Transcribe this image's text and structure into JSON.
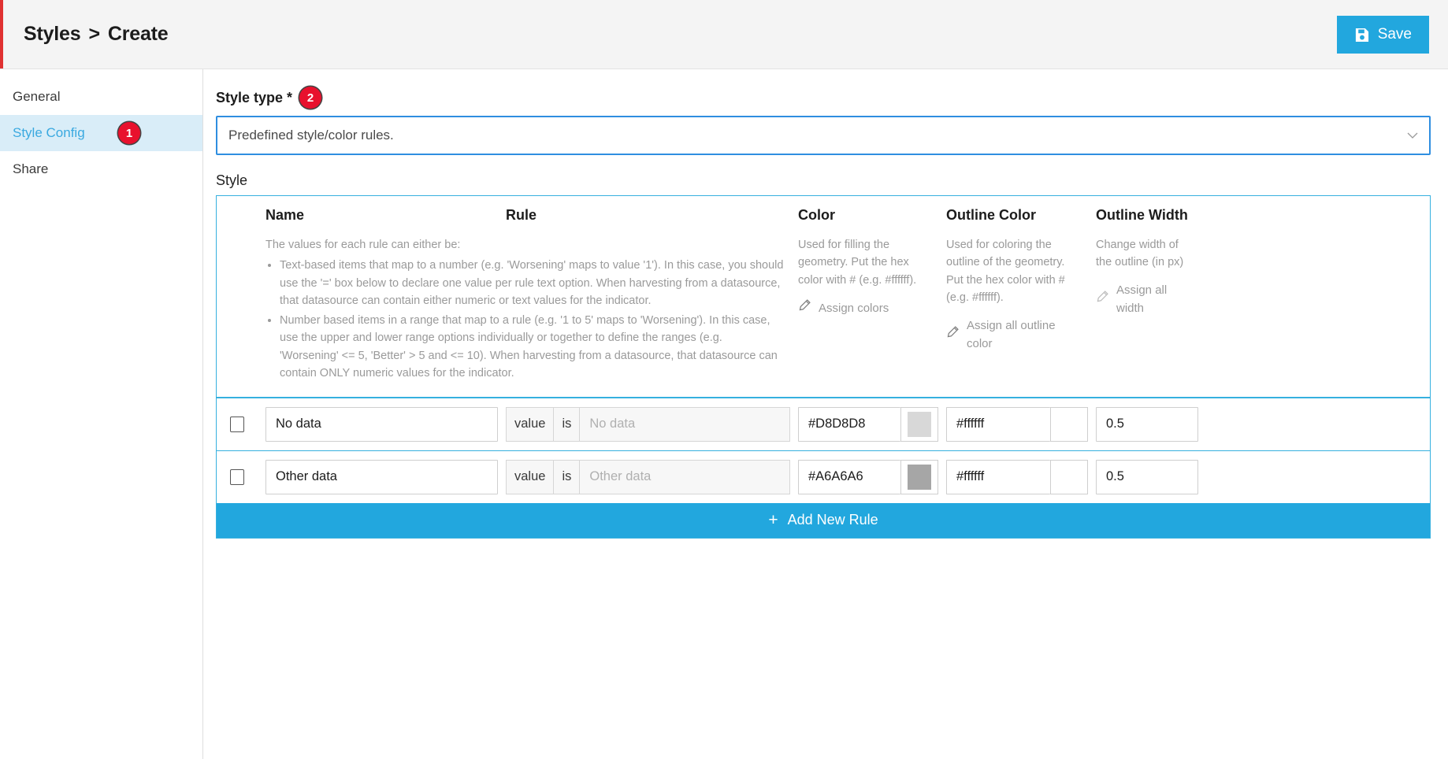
{
  "header": {
    "breadcrumb_root": "Styles",
    "breadcrumb_sep": ">",
    "breadcrumb_current": "Create",
    "save_label": "Save",
    "save_icon": "floppy-disk-icon",
    "accent_color": "#e8112d",
    "save_bg": "#22a7de"
  },
  "sidebar": {
    "items": [
      {
        "label": "General",
        "active": false,
        "badge": ""
      },
      {
        "label": "Style Config",
        "active": true,
        "badge": "1"
      },
      {
        "label": "Share",
        "active": false,
        "badge": ""
      }
    ]
  },
  "main": {
    "style_type_label": "Style type *",
    "style_type_badge": "2",
    "style_type_value": "Predefined style/color rules.",
    "style_type_chevron": "chevron-down-icon",
    "style_section_label": "Style"
  },
  "table": {
    "columns": {
      "name": "Name",
      "rule": "Rule",
      "color": "Color",
      "outline_color": "Outline Color",
      "outline_width": "Outline Width"
    },
    "name_rule_description": {
      "intro": "The values for each rule can either be:",
      "bullets": [
        "Text-based items that map to a number (e.g. 'Worsening' maps to value '1'). In this case, you should use the '=' box below to declare one value per rule text option. When harvesting from a datasource, that datasource can contain either numeric or text values for the indicator.",
        "Number based items in a range that map to a rule (e.g. '1 to 5' maps to 'Worsening'). In this case, use the upper and lower range options individually or together to define the ranges (e.g. 'Worsening' <= 5, 'Better' > 5 and <= 10). When harvesting from a datasource, that datasource can contain ONLY numeric values for the indicator."
      ]
    },
    "color_description": "Used for filling the geometry. Put the hex color with # (e.g. #ffffff).",
    "color_assign_link": "Assign colors",
    "outline_color_description": "Used for coloring the outline of the geometry. Put the hex color with # (e.g. #ffffff).",
    "outline_color_assign_link": "Assign all outline color",
    "outline_width_description": "Change width of the outline (in px)",
    "outline_width_assign_link": "Assign all width",
    "assign_icon": "pencil-icon",
    "rows": [
      {
        "checked": false,
        "name": "No data",
        "rule_tag_value": "value",
        "rule_tag_is": "is",
        "rule_placeholder": "No data",
        "rule_value": "",
        "color": "#D8D8D8",
        "color_swatch": "#D8D8D8",
        "outline_color": "#ffffff",
        "outline_swatch": "#ffffff",
        "outline_width": "0.5"
      },
      {
        "checked": false,
        "name": "Other data",
        "rule_tag_value": "value",
        "rule_tag_is": "is",
        "rule_placeholder": "Other data",
        "rule_value": "",
        "color": "#A6A6A6",
        "color_swatch": "#A6A6A6",
        "outline_color": "#ffffff",
        "outline_swatch": "#ffffff",
        "outline_width": "0.5"
      }
    ],
    "add_rule_label": "Add New Rule",
    "add_rule_plus": "+"
  }
}
